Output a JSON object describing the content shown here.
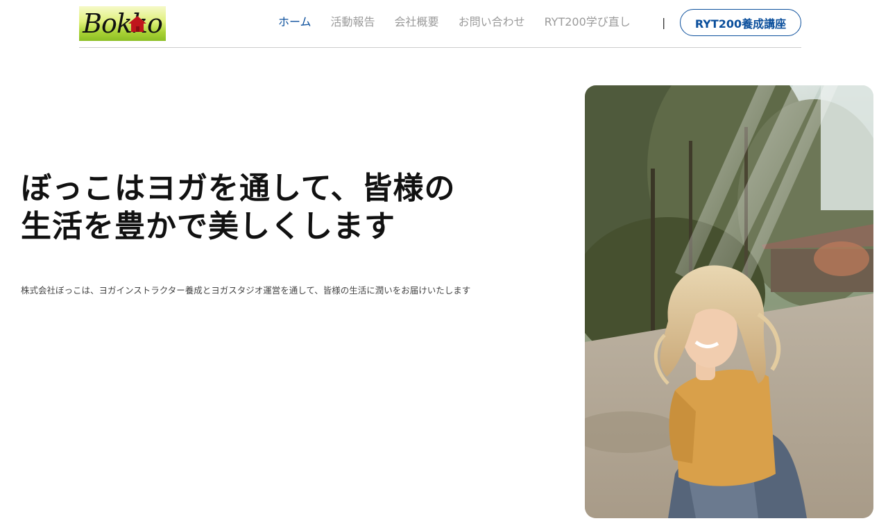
{
  "header": {
    "logo_text": "Bokko",
    "nav": [
      {
        "label": "ホーム",
        "active": true
      },
      {
        "label": "活動報告"
      },
      {
        "label": "会社概要"
      },
      {
        "label": "お問い合わせ"
      },
      {
        "label": "RYT200学び直し"
      }
    ],
    "separator": "|",
    "cta_label": "RYT200養成講座"
  },
  "hero": {
    "title_line1": "ぼっこはヨガを通して、皆様の",
    "title_line2": "生活を豊かで美しくします",
    "description": "株式会社ぼっこは、ヨガインストラクター養成とヨガスタジオ運営を通して、皆様の生活に潤いをお届けいたします"
  },
  "colors": {
    "accent": "#0b4f9c",
    "nav_inactive": "#9a9a9a",
    "text": "#111111"
  }
}
